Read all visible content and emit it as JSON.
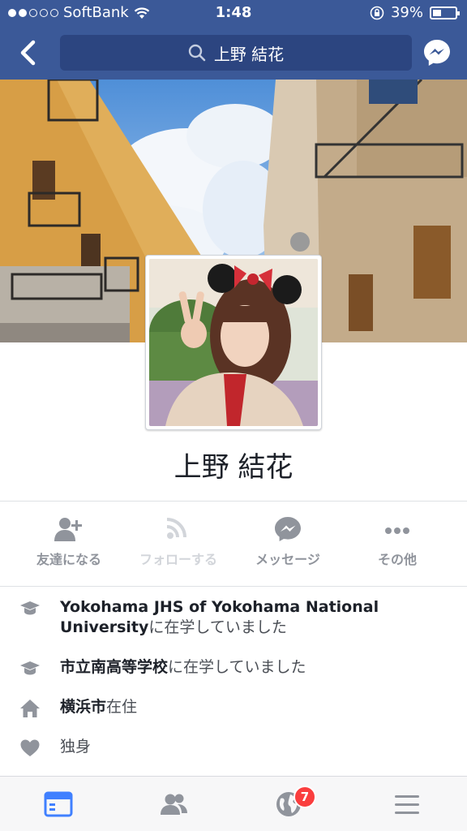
{
  "status_bar": {
    "carrier": "SoftBank",
    "time": "1:48",
    "battery": "39%",
    "battery_level": 0.39,
    "signal_bars": 2
  },
  "header": {
    "search_text": "上野 結花",
    "bg_color": "#3b5998"
  },
  "profile": {
    "name": "上野 結花"
  },
  "actions": [
    {
      "label": "友達になる",
      "icon": "add-friend-icon",
      "enabled": true
    },
    {
      "label": "フォローする",
      "icon": "follow-rss-icon",
      "enabled": false
    },
    {
      "label": "メッセージ",
      "icon": "messenger-icon",
      "enabled": true
    },
    {
      "label": "その他",
      "icon": "more-dots-icon",
      "enabled": true
    }
  ],
  "info": {
    "edu1_bold": "Yokohama JHS of Yokohama National University",
    "edu1_suffix": "に在学していました",
    "edu2_bold": "市立南高等学校",
    "edu2_suffix": "に在学していました",
    "home_bold": "横浜市",
    "home_suffix": "在住",
    "relationship": "独身"
  },
  "tabbar": {
    "notifications_count": "7",
    "active_tab": "news-feed",
    "accent": "#4080ff"
  }
}
